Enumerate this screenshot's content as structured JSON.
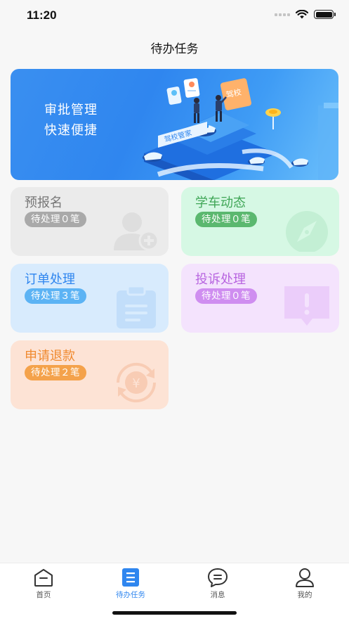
{
  "status_bar": {
    "time": "11:20"
  },
  "header": {
    "title": "待办任务"
  },
  "banner": {
    "line1": "审批管理",
    "line2": "快速便捷",
    "sign_text": "驾校管家",
    "flag_text": "驾校"
  },
  "cards": [
    {
      "title": "预报名",
      "badge": "待处理０笔",
      "icon": "add-user-icon"
    },
    {
      "title": "学车动态",
      "badge": "待处理０笔",
      "icon": "compass-icon"
    },
    {
      "title": "订单处理",
      "badge": "待处理３笔",
      "icon": "clipboard-icon"
    },
    {
      "title": "投诉处理",
      "badge": "待处理０笔",
      "icon": "alert-message-icon"
    },
    {
      "title": "申请退款",
      "badge": "待处理２笔",
      "icon": "yuan-refund-icon"
    }
  ],
  "colors": {
    "accent": "#2f86ef",
    "card_gray": "#ebebeb",
    "badge_gray": "#a9a9a9",
    "title_gray": "#777777",
    "card_green": "#d6f8e4",
    "badge_green": "#5bb86f",
    "title_green": "#3fa656",
    "card_blue": "#d8ebfd",
    "badge_blue": "#5cb3f4",
    "title_blue": "#2f86ef",
    "card_purple": "#f4e3fd",
    "badge_purple": "#cf8ef0",
    "title_purple": "#b865e0",
    "card_orange": "#fde3d5",
    "badge_orange": "#f4a24b",
    "title_orange": "#f0892e"
  },
  "tabbar": {
    "items": [
      {
        "label": "首页",
        "icon": "home-icon",
        "active": false
      },
      {
        "label": "待办任务",
        "icon": "task-list-icon",
        "active": true
      },
      {
        "label": "消息",
        "icon": "message-icon",
        "active": false
      },
      {
        "label": "我的",
        "icon": "profile-icon",
        "active": false
      }
    ]
  }
}
